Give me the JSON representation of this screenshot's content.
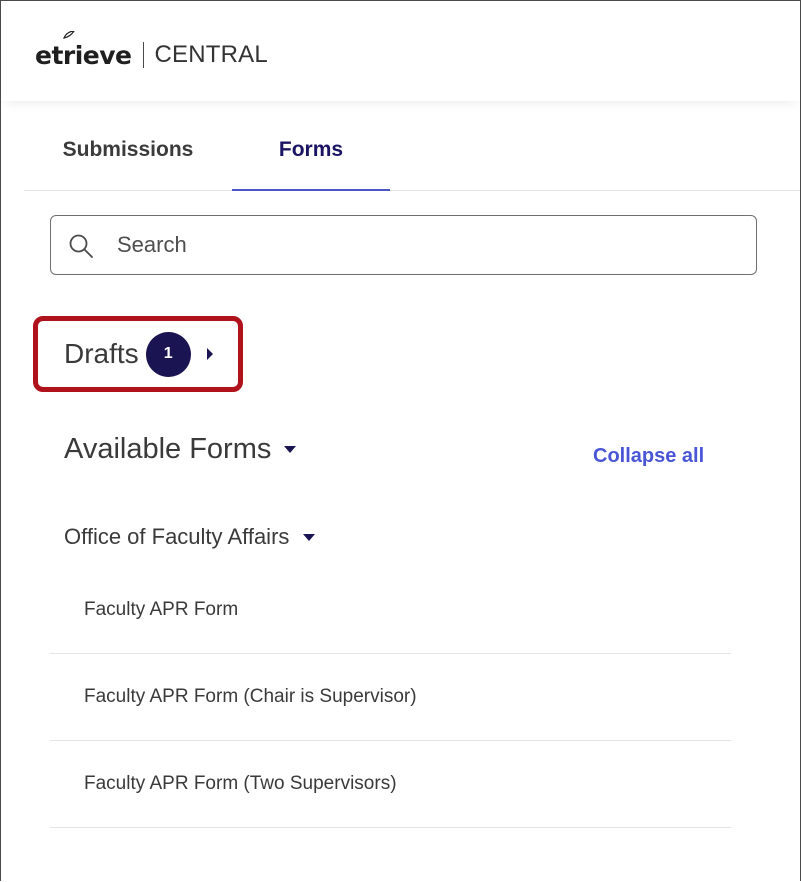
{
  "header": {
    "logo_text": "etrieve",
    "product_name": "CENTRAL"
  },
  "tabs": [
    {
      "label": "Submissions",
      "active": false
    },
    {
      "label": "Forms",
      "active": true
    }
  ],
  "search": {
    "placeholder": "Search",
    "value": ""
  },
  "drafts": {
    "label": "Drafts",
    "count": "1",
    "expanded": false
  },
  "available_forms": {
    "title": "Available Forms",
    "collapse_all_label": "Collapse all",
    "departments": [
      {
        "name": "Office of Faculty Affairs",
        "forms": [
          "Faculty APR Form",
          "Faculty APR Form (Chair is Supervisor)",
          "Faculty APR Form (Two Supervisors)"
        ]
      }
    ]
  },
  "colors": {
    "brand_navy": "#1b1452",
    "accent_blue": "#4a56d6",
    "highlight_red": "#b0121b",
    "text": "#3a3a3a"
  },
  "icons": {
    "search": "search-icon",
    "drafts_toggle": "caret-right-icon",
    "section_toggle": "caret-down-icon"
  }
}
